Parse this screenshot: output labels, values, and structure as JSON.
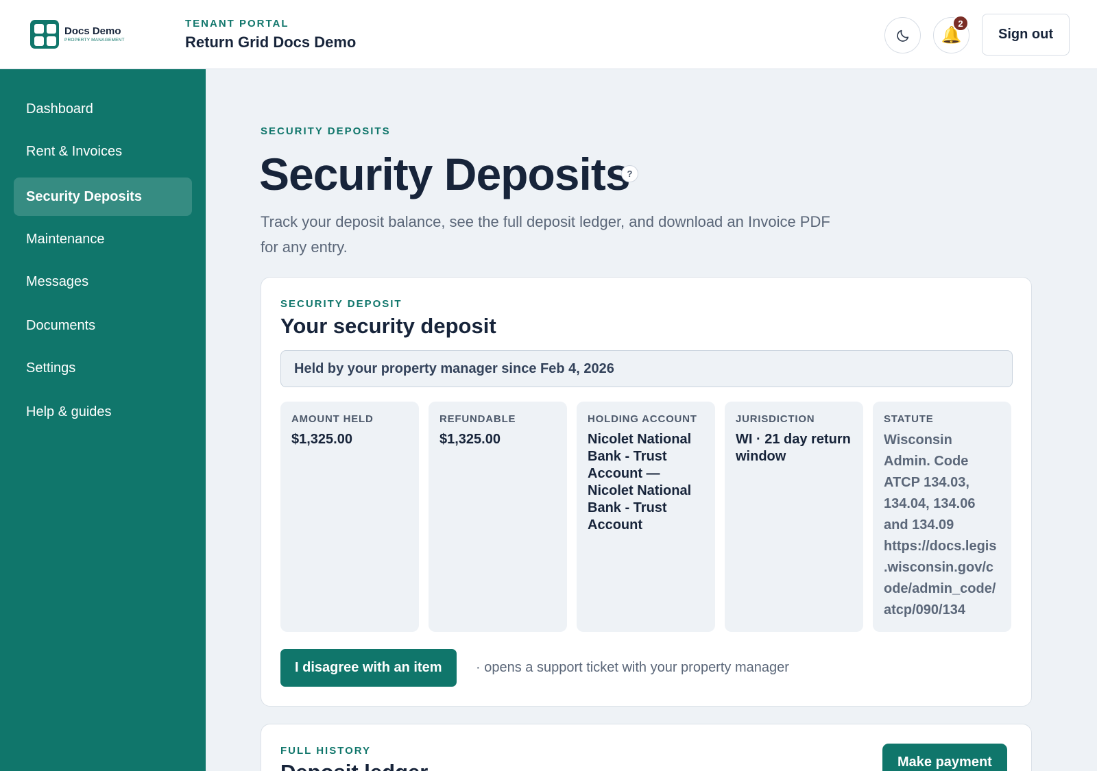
{
  "brand": {
    "name": "Docs Demo",
    "subtitle": "PROPERTY MANAGEMENT"
  },
  "header": {
    "kicker": "TENANT PORTAL",
    "title": "Return Grid Docs Demo",
    "notification_count": "2",
    "sign_out_label": "Sign out",
    "theme_icon": "moon-icon",
    "bell_icon": "bell-icon"
  },
  "sidebar": {
    "items": [
      {
        "label": "Dashboard"
      },
      {
        "label": "Rent & Invoices"
      },
      {
        "label": "Security Deposits",
        "active": true
      },
      {
        "label": "Maintenance"
      },
      {
        "label": "Messages"
      },
      {
        "label": "Documents"
      },
      {
        "label": "Settings"
      },
      {
        "label": "Help & guides"
      }
    ]
  },
  "page": {
    "kicker": "SECURITY DEPOSITS",
    "title": "Security Deposits",
    "help_icon": "?",
    "description": "Track your deposit balance, see the full deposit ledger, and download an Invoice PDF for any entry."
  },
  "deposit_card": {
    "kicker": "SECURITY DEPOSIT",
    "title": "Your security deposit",
    "held_banner": "Held by your property manager since Feb 4, 2026",
    "stats": [
      {
        "label": "Amount held",
        "value": "$1,325.00"
      },
      {
        "label": "Refundable",
        "value": "$1,325.00"
      },
      {
        "label": "Holding account",
        "value": "Nicolet National Bank - Trust Account — Nicolet National Bank - Trust Account"
      },
      {
        "label": "Jurisdiction",
        "value": "WI · 21 day return window"
      },
      {
        "label": "Statute",
        "value": "Wisconsin Admin. Code ATCP 134.03, 134.04, 134.06 and 134.09 https://docs.legis.wisconsin.gov/code/admin_code/atcp/090/134"
      }
    ],
    "dispute_button": "I disagree with an item",
    "dispute_note": "· opens a support ticket with your property manager"
  },
  "ledger_card": {
    "kicker": "FULL HISTORY",
    "title": "Deposit ledger",
    "make_payment_label": "Make payment"
  },
  "colors": {
    "brand": "#10766b",
    "badge": "#7a2d25",
    "background": "#eef2f6"
  }
}
